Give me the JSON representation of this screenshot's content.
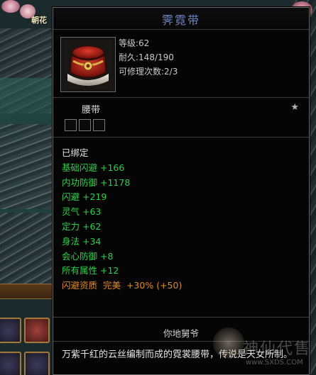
{
  "scene": {
    "label": "朝花"
  },
  "item": {
    "name": "霁霓带",
    "level": "等级:62",
    "durability": "耐久:148/190",
    "repair": "可修理次数:2/3",
    "type": "腰带",
    "icon": "belt-icon"
  },
  "attributes": {
    "bound": "已绑定",
    "rows": [
      {
        "name": "基础闪避",
        "value": "+166"
      },
      {
        "name": "内功防御",
        "value": "+1178"
      },
      {
        "name": "闪避",
        "value": "+219"
      },
      {
        "name": "灵气",
        "value": "+63"
      },
      {
        "name": "定力",
        "value": "+62"
      },
      {
        "name": "身法",
        "value": "+34"
      },
      {
        "name": "会心防御",
        "value": "+8"
      },
      {
        "name": "所有属性",
        "value": "+12"
      }
    ],
    "quality": {
      "name": "闪避资质",
      "grade": "完美",
      "bonus": "+30%",
      "extra": "(+50)"
    }
  },
  "signature": "你地舅爷",
  "description": "万紫千红的云丝编制而成的霓裳腰带，传说是天女所制。",
  "watermark": {
    "text": "神仙代售",
    "url": "www.SXDS.COM"
  },
  "colors": {
    "title": "#6f86c8",
    "attribute": "#2fd04a",
    "quality": "#e08a24"
  }
}
